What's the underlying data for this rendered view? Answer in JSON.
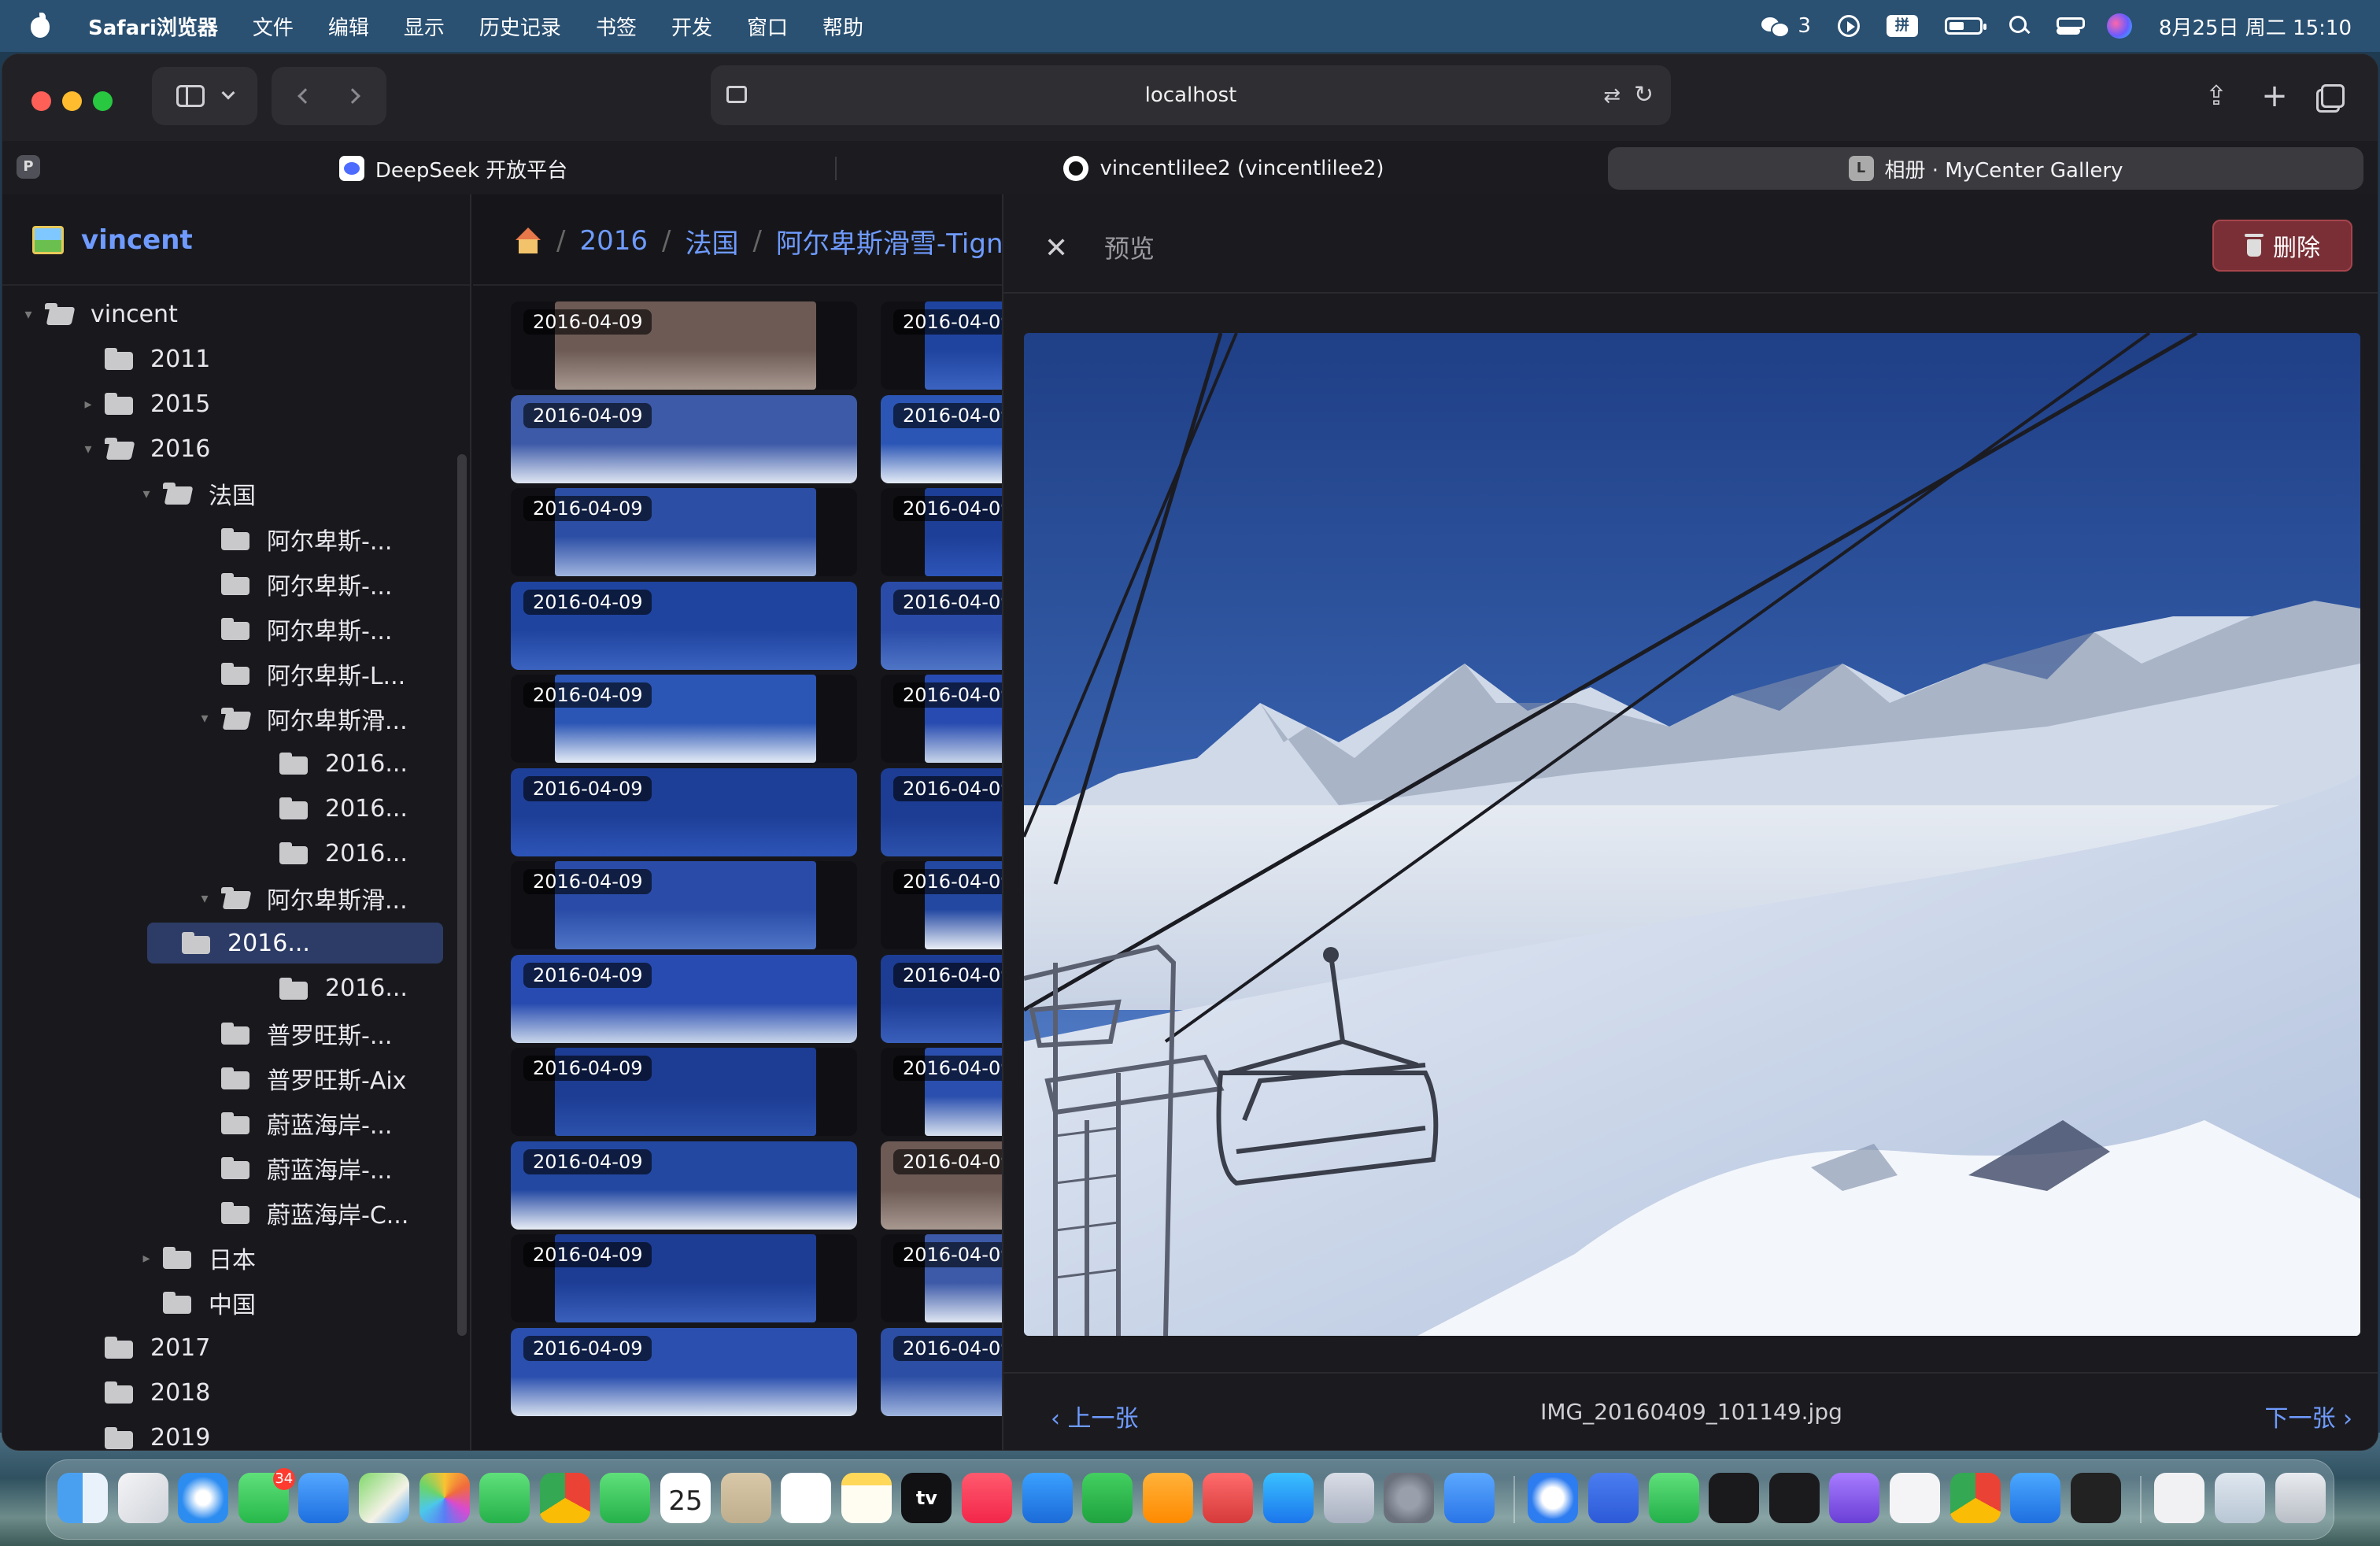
{
  "menubar": {
    "app_name": "Safari浏览器",
    "items": [
      "文件",
      "编辑",
      "显示",
      "历史记录",
      "书签",
      "开发",
      "窗口",
      "帮助"
    ],
    "wechat_count": "3",
    "ime_label": "拼",
    "datetime": "8月25日 周二 15:10"
  },
  "browser": {
    "address": "localhost",
    "pill_label": "P",
    "tabs": [
      {
        "title": "DeepSeek 开放平台",
        "favicon": "deepseek-icon"
      },
      {
        "title": "vincentlilee2 (vincentlilee2)",
        "favicon": "github-icon"
      },
      {
        "title": "相册 · MyCenter Gallery",
        "favicon": "L",
        "active": true
      }
    ]
  },
  "sidebar": {
    "brand": "vincent",
    "tree": [
      {
        "label": "vincent",
        "depth": 0,
        "arrow": "▾"
      },
      {
        "label": "2011",
        "depth": 1,
        "arrow": ""
      },
      {
        "label": "2015",
        "depth": 1,
        "arrow": "▸"
      },
      {
        "label": "2016",
        "depth": 1,
        "arrow": "▾"
      },
      {
        "label": "法国",
        "depth": 2,
        "arrow": "▾"
      },
      {
        "label": "阿尔卑斯-...",
        "depth": 3,
        "arrow": ""
      },
      {
        "label": "阿尔卑斯-...",
        "depth": 3,
        "arrow": ""
      },
      {
        "label": "阿尔卑斯-...",
        "depth": 3,
        "arrow": ""
      },
      {
        "label": "阿尔卑斯-L...",
        "depth": 3,
        "arrow": ""
      },
      {
        "label": "阿尔卑斯滑...",
        "depth": 3,
        "arrow": "▾"
      },
      {
        "label": "2016...",
        "depth": 4,
        "arrow": ""
      },
      {
        "label": "2016...",
        "depth": 4,
        "arrow": ""
      },
      {
        "label": "2016...",
        "depth": 4,
        "arrow": ""
      },
      {
        "label": "阿尔卑斯滑...",
        "depth": 3,
        "arrow": "▾"
      },
      {
        "label": "2016...",
        "depth": 4,
        "arrow": "",
        "selected": true
      },
      {
        "label": "2016...",
        "depth": 4,
        "arrow": ""
      },
      {
        "label": "普罗旺斯-...",
        "depth": 3,
        "arrow": ""
      },
      {
        "label": "普罗旺斯-Aix",
        "depth": 3,
        "arrow": ""
      },
      {
        "label": "蔚蓝海岸-...",
        "depth": 3,
        "arrow": ""
      },
      {
        "label": "蔚蓝海岸-...",
        "depth": 3,
        "arrow": ""
      },
      {
        "label": "蔚蓝海岸-C...",
        "depth": 3,
        "arrow": ""
      },
      {
        "label": "日本",
        "depth": 2,
        "arrow": "▸"
      },
      {
        "label": "中国",
        "depth": 2,
        "arrow": ""
      },
      {
        "label": "2017",
        "depth": 1,
        "arrow": ""
      },
      {
        "label": "2018",
        "depth": 1,
        "arrow": ""
      },
      {
        "label": "2019",
        "depth": 1,
        "arrow": ""
      }
    ]
  },
  "breadcrumb": {
    "home_icon": "home-icon",
    "items": [
      "2016",
      "法国",
      "阿尔卑斯滑雪-Tign"
    ],
    "separator": "/"
  },
  "grid": {
    "date": "2016-04-09",
    "rows": 12,
    "columns": 2
  },
  "preview": {
    "title": "预览",
    "close_icon": "close-icon",
    "delete_label": "删除",
    "prev_label": "‹ 上一张",
    "next_label": "下一张 ›",
    "filename": "IMG_20160409_101149.jpg"
  },
  "colors": {
    "accent": "#6f9bff",
    "delete": "#7a2f36",
    "selected": "#2d3c66"
  },
  "dock": {
    "calendar_day": "25",
    "messages_badge": "34",
    "tv_label": "tv"
  }
}
